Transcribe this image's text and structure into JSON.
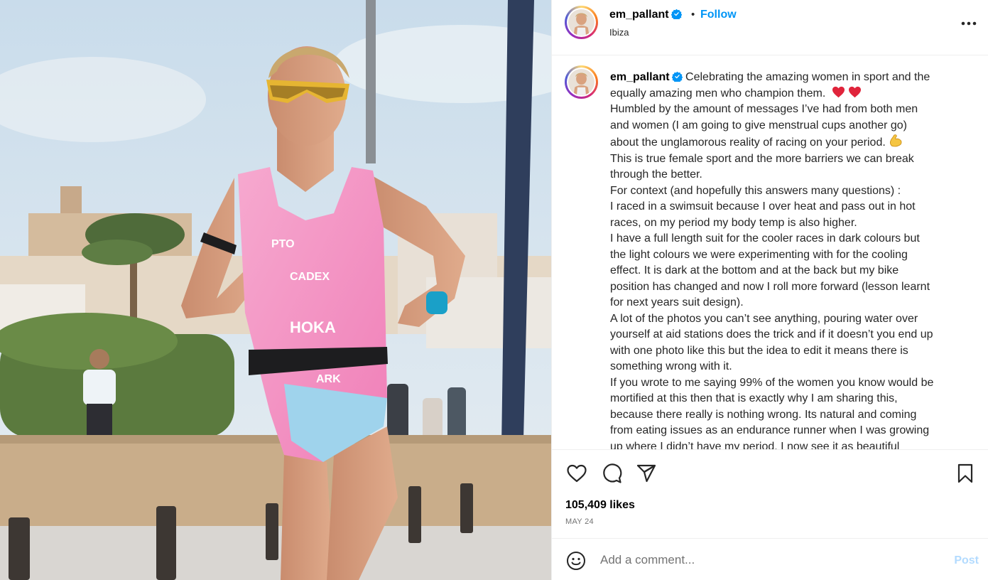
{
  "header": {
    "username": "em_pallant",
    "separator": "•",
    "follow_label": "Follow",
    "location": "Ibiza",
    "more_icon": "more-horizontal-icon"
  },
  "caption": {
    "username": "em_pallant",
    "lines": [
      "Celebrating the amazing women in sport and the",
      "equally amazing men who champion them.",
      "Humbled by the amount of messages I’ve had from both men",
      "and women (I am going to give menstrual cups another go)",
      "about the unglamorous reality of racing on your period.",
      "This is true female sport and the more barriers we can break",
      "through the better.",
      "For context (and hopefully this answers many questions) :",
      "I raced in a swimsuit because I over heat and pass out in hot",
      "races, on my period my body temp is also higher.",
      "I have a full length suit for the cooler races in dark colours but",
      "the light colours we were experimenting with for the cooling",
      "effect. It is dark at the bottom and at the back but my bike",
      "position has changed and now I roll more forward (lesson learnt",
      "for next years suit design).",
      "A lot of the photos you can’t see anything, pouring water over",
      "yourself at aid stations does the trick and if it doesn’t you end up",
      "with one photo like this but the idea to edit it means there is",
      "something wrong with it.",
      "If you wrote to me saying 99% of the women you know would be",
      "mortified at this then that is exactly why I am sharing this,",
      "because there really is nothing wrong. Its natural and coming",
      "from eating issues as an endurance runner when I was growing",
      "up where I didn’t have my period. I now see it as beautiful"
    ],
    "emoji": [
      "red-heart-icon",
      "red-heart-icon",
      "flexed-biceps-icon"
    ]
  },
  "actions": {
    "like_icon": "heart-outline-icon",
    "comment_icon": "comment-icon",
    "share_icon": "paper-plane-icon",
    "save_icon": "bookmark-icon"
  },
  "stats": {
    "likes": "105,409 likes",
    "date": "MAY 24"
  },
  "comment": {
    "placeholder": "Add a comment...",
    "post_label": "Post",
    "emoji_icon": "smiley-icon"
  },
  "colors": {
    "accent": "#0095f6",
    "post_disabled": "#b3dbff",
    "border": "#efefef",
    "muted": "#737373",
    "heart_red": "#e0243b"
  }
}
